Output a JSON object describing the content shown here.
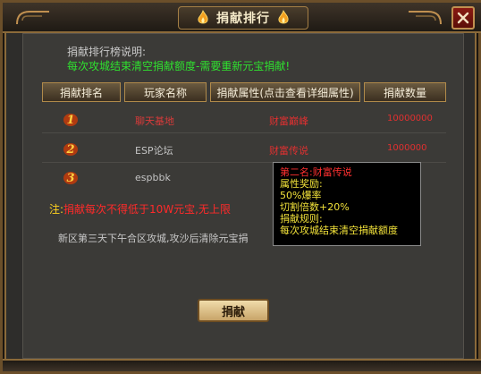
{
  "window": {
    "title": "捐献排行"
  },
  "description": {
    "label": "捐献排行榜说明:",
    "text": "每次攻城结束清空捐献额度-需要重新元宝捐献!"
  },
  "columns": {
    "rank": "捐献排名",
    "player": "玩家名称",
    "attr": "捐献属性(点击查看详细属性)",
    "amount": "捐献数量"
  },
  "rows": [
    {
      "rank": "1",
      "player": "聊天基地",
      "title": "财富巅峰",
      "amount": "10000000"
    },
    {
      "rank": "2",
      "player": "ESP论坛",
      "title": "财富传说",
      "amount": "1000000"
    },
    {
      "rank": "3",
      "player": "espbbk",
      "title": "",
      "amount": ""
    }
  ],
  "note": {
    "prefix": "注:",
    "text": "捐献每次不得低于10W元宝,无上限"
  },
  "notice": "新区第三天下午合区攻城,攻沙后清除元宝捐",
  "tooltip": {
    "title": "第二名:财富传说",
    "lines": [
      "属性奖励:",
      "50%爆率",
      "切割倍数+20%",
      "捐献规则:",
      "每次攻城结束清空捐献额度"
    ]
  },
  "donate_button": "捐献",
  "colors": {
    "accent_gold": "#b08a4a",
    "desc_green": "#2fe02f",
    "rank_red": "#e03030",
    "tooltip_yellow": "#f2e23a"
  }
}
